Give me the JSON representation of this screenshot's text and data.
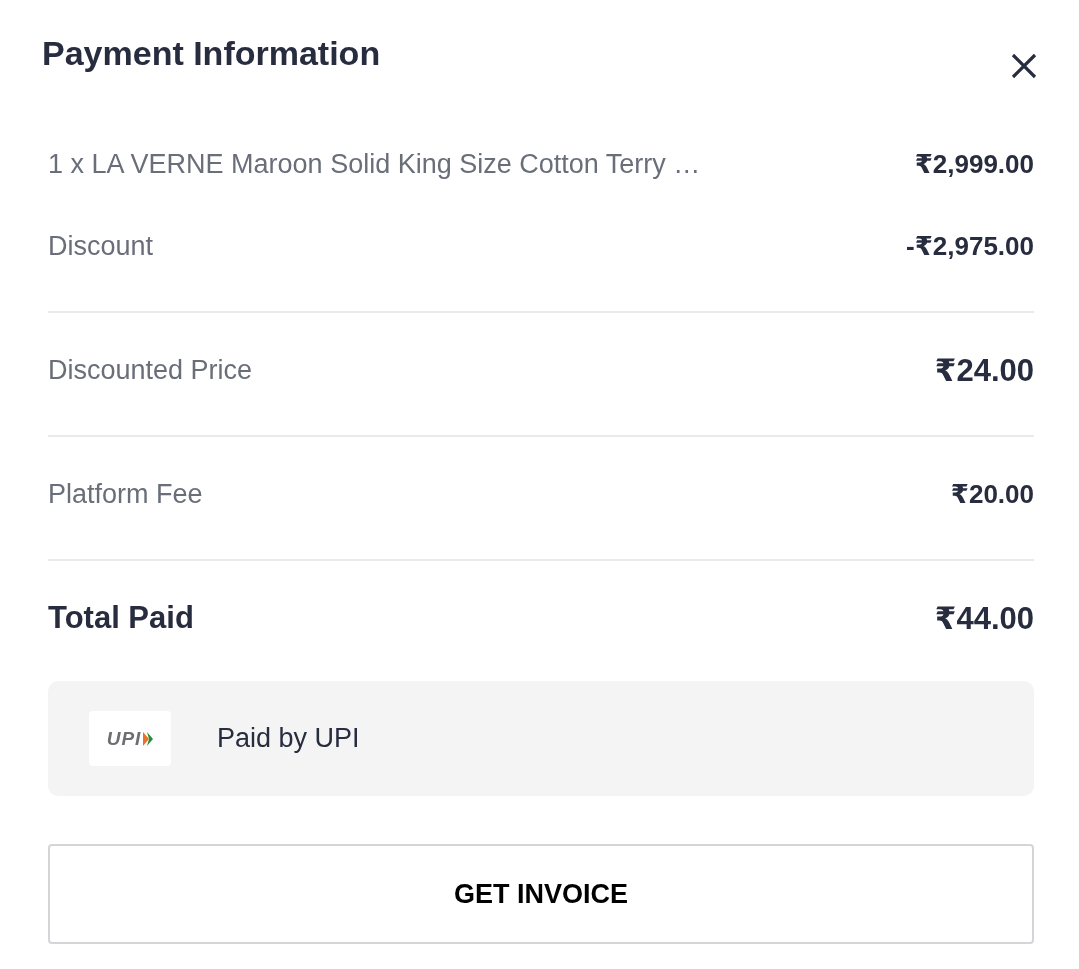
{
  "dialog": {
    "title": "Payment Information"
  },
  "sections": [
    {
      "rows": [
        {
          "kind": "line",
          "label": "1 x LA VERNE Maroon Solid King Size Cotton Terry …",
          "amount": "₹2,999.00"
        },
        {
          "kind": "line",
          "label": "Discount",
          "amount": "-₹2,975.00"
        }
      ]
    },
    {
      "rows": [
        {
          "kind": "subtotal",
          "label": "Discounted Price",
          "amount": "₹24.00"
        }
      ]
    },
    {
      "rows": [
        {
          "kind": "line",
          "label": "Platform Fee",
          "amount": "₹20.00"
        }
      ]
    },
    {
      "rows": [
        {
          "kind": "total",
          "label": "Total Paid",
          "amount": "₹44.00"
        }
      ]
    }
  ],
  "payment_method": {
    "logo_text": "UPI",
    "label": "Paid by UPI"
  },
  "buttons": [
    {
      "label": "GET INVOICE"
    }
  ]
}
